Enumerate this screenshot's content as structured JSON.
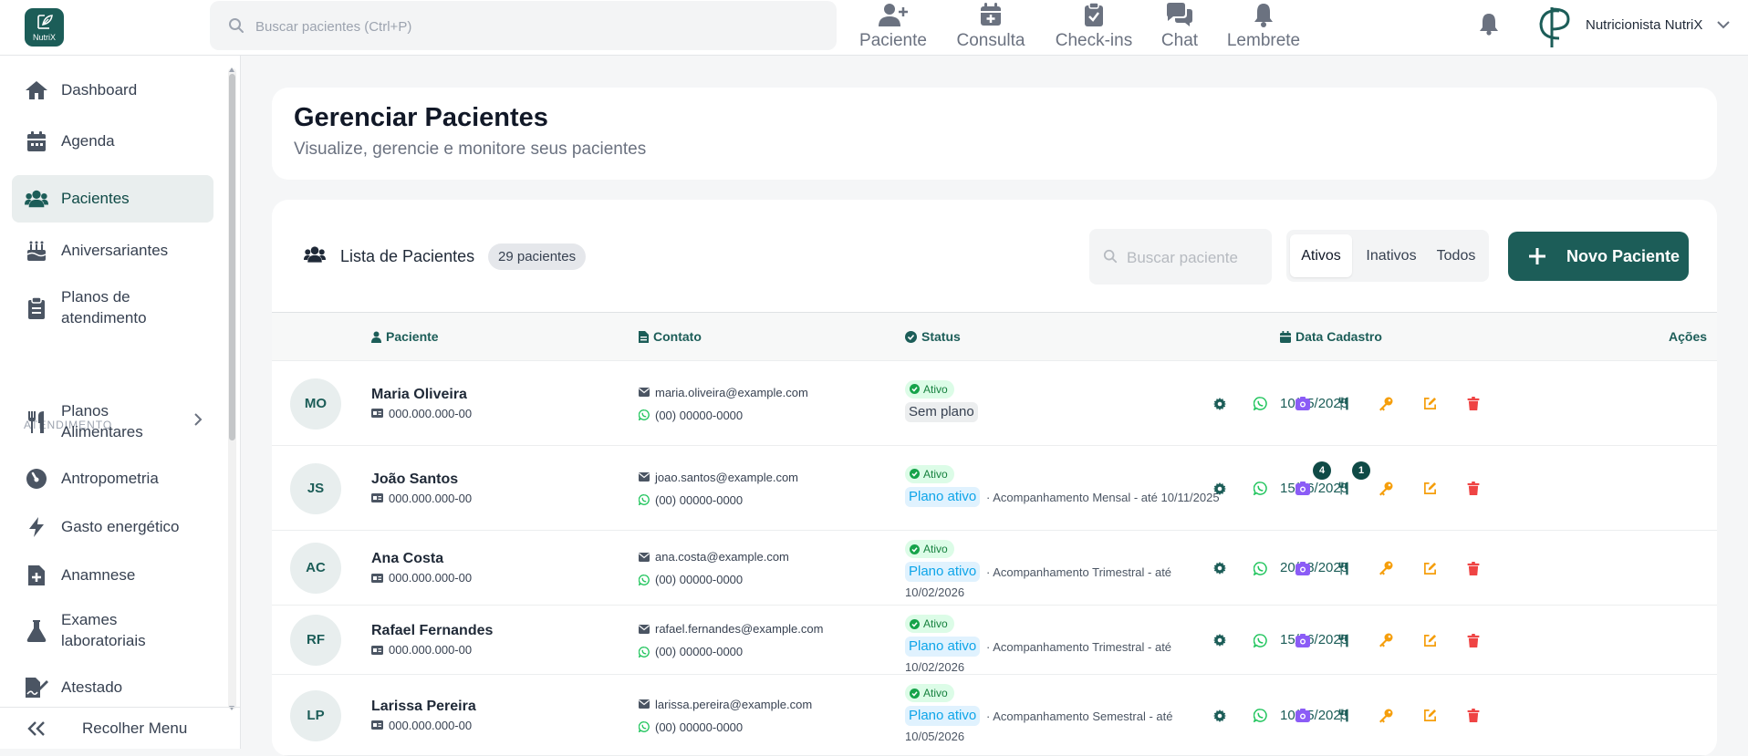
{
  "app": {
    "logo_text": "NutriX"
  },
  "topbar": {
    "search_placeholder": "Buscar pacientes (Ctrl+P)",
    "quick_actions": [
      {
        "label": "Paciente",
        "icon": "user-plus-icon"
      },
      {
        "label": "Consulta",
        "icon": "calendar-plus-icon"
      },
      {
        "label": "Check-ins",
        "icon": "clipboard-check-icon"
      },
      {
        "label": "Chat",
        "icon": "chat-icon"
      },
      {
        "label": "Lembrete",
        "icon": "bell-icon"
      }
    ],
    "user_name": "Nutricionista NutriX"
  },
  "sidebar": {
    "items": [
      {
        "label": "Dashboard",
        "icon": "home-icon"
      },
      {
        "label": "Agenda",
        "icon": "calendar-icon"
      },
      {
        "label": "Pacientes",
        "icon": "users-icon",
        "active": true
      },
      {
        "label": "Aniversariantes",
        "icon": "birthday-cake-icon"
      },
      {
        "label": "Planos de atendimento",
        "icon": "clipboard-list-icon"
      }
    ],
    "section_label": "ATENDIMENTO",
    "section_items": [
      {
        "label": "Planos Alimentares",
        "icon": "utensils-icon"
      },
      {
        "label": "Antropometria",
        "icon": "gauge-icon"
      },
      {
        "label": "Gasto energético",
        "icon": "bolt-icon"
      },
      {
        "label": "Anamnese",
        "icon": "file-medical-icon"
      },
      {
        "label": "Exames laboratoriais",
        "icon": "flask-icon"
      },
      {
        "label": "Atestado",
        "icon": "file-signature-icon"
      }
    ],
    "collapse_label": "Recolher Menu"
  },
  "header": {
    "title": "Gerenciar Pacientes",
    "subtitle": "Visualize, gerencie e monitore seus pacientes"
  },
  "list": {
    "title": "Lista de Pacientes",
    "count": "29 pacientes",
    "search_placeholder": "Buscar paciente",
    "filters": [
      "Ativos",
      "Inativos",
      "Todos"
    ],
    "active_filter": "Ativos",
    "new_button": "Novo Paciente",
    "columns": [
      "Paciente",
      "Contato",
      "Status",
      "Data Cadastro",
      "Ações"
    ],
    "rows": [
      {
        "initials": "MO",
        "name": "Maria Oliveira",
        "cpf": "000.000.000-00",
        "email": "maria.oliveira@example.com",
        "phone": "(00) 00000-0000",
        "status": "Ativo",
        "plan": "Sem plano",
        "plan_desc": "",
        "plan_desc_cont": "",
        "date": "10/05/2025",
        "photo_count": "",
        "meal_count": ""
      },
      {
        "initials": "JS",
        "name": "João Santos",
        "cpf": "000.000.000-00",
        "email": "joao.santos@example.com",
        "phone": "(00) 00000-0000",
        "status": "Ativo",
        "plan": "Plano ativo",
        "plan_desc": "· Acompanhamento Mensal - até 10/11/2025",
        "plan_desc_cont": "",
        "date": "15/06/2025",
        "photo_count": "4",
        "meal_count": "1"
      },
      {
        "initials": "AC",
        "name": "Ana Costa",
        "cpf": "000.000.000-00",
        "email": "ana.costa@example.com",
        "phone": "(00) 00000-0000",
        "status": "Ativo",
        "plan": "Plano ativo",
        "plan_desc": "· Acompanhamento Trimestral - até",
        "plan_desc_cont": "10/02/2026",
        "date": "20/08/2025",
        "photo_count": "",
        "meal_count": ""
      },
      {
        "initials": "RF",
        "name": "Rafael Fernandes",
        "cpf": "000.000.000-00",
        "email": "rafael.fernandes@example.com",
        "phone": "(00) 00000-0000",
        "status": "Ativo",
        "plan": "Plano ativo",
        "plan_desc": "· Acompanhamento Trimestral - até",
        "plan_desc_cont": "10/02/2026",
        "date": "15/06/2025",
        "photo_count": "",
        "meal_count": ""
      },
      {
        "initials": "LP",
        "name": "Larissa Pereira",
        "cpf": "000.000.000-00",
        "email": "larissa.pereira@example.com",
        "phone": "(00) 00000-0000",
        "status": "Ativo",
        "plan": "Plano ativo",
        "plan_desc": "· Acompanhamento Semestral - até",
        "plan_desc_cont": "10/05/2026",
        "date": "10/05/2025",
        "photo_count": "",
        "meal_count": ""
      }
    ]
  },
  "colors": {
    "brand": "#1c5d58",
    "status_active": "#15803d",
    "plan_active": "#0ea5e9",
    "action_settings": "#1c5d58",
    "action_whatsapp": "#22c55e",
    "action_photos": "#8b5cf6",
    "action_meal": "#1c5d58",
    "action_key": "#f59e0b",
    "action_edit": "#f59e0b",
    "action_delete": "#ef4444"
  }
}
